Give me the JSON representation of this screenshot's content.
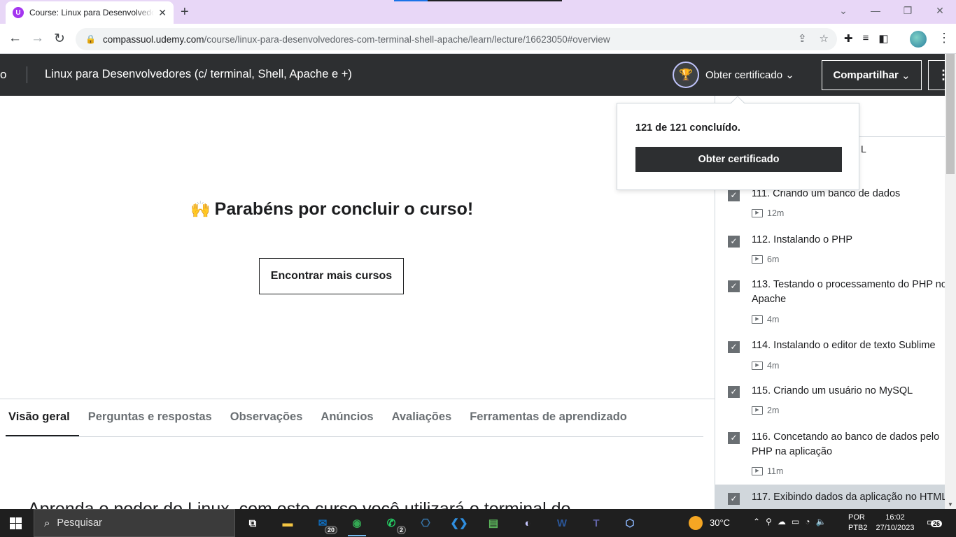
{
  "browser": {
    "tab_title": "Course: Linux para Desenvolvedores",
    "url_host": "compassuol.udemy.com",
    "url_path": "/course/linux-para-desenvolvedores-com-terminal-shell-apache/learn/lecture/16623050#overview"
  },
  "header": {
    "left_fragment": "o",
    "course_title": "Linux para Desenvolvedores (c/ terminal, Shell, Apache e +)",
    "get_certificate": "Obter certificado",
    "share": "Compartilhar"
  },
  "popover": {
    "progress": "121 de 121 concluído.",
    "button": "Obter certificado"
  },
  "main": {
    "emoji": "🙌",
    "congrats": "Parabéns por concluir o curso!",
    "find_more": "Encontrar mais cursos",
    "tabs": [
      {
        "label": "Visão geral",
        "active": true
      },
      {
        "label": "Perguntas e respostas",
        "active": false
      },
      {
        "label": "Observações",
        "active": false
      },
      {
        "label": "Anúncios",
        "active": false
      },
      {
        "label": "Avaliações",
        "active": false
      },
      {
        "label": "Ferramentas de aprendizado",
        "active": false
      }
    ],
    "description": "Aprenda o poder do Linux, com este curso você utilizará o terminal do"
  },
  "sidebar": {
    "hidden_fragment": "L",
    "lectures": [
      {
        "title": "111. Criando um banco de dados",
        "duration": "12m",
        "done": true
      },
      {
        "title": "112. Instalando o PHP",
        "duration": "6m",
        "done": true
      },
      {
        "title": "113. Testando o processamento do PHP no Apache",
        "duration": "4m",
        "done": true
      },
      {
        "title": "114. Instalando o editor de texto Sublime",
        "duration": "4m",
        "done": true
      },
      {
        "title": "115. Criando um usuário no MySQL",
        "duration": "2m",
        "done": true
      },
      {
        "title": "116. Concetando ao banco de dados pelo PHP na aplicação",
        "duration": "11m",
        "done": true
      },
      {
        "title": "117. Exibindo dados da aplicação no HTML",
        "duration": "",
        "done": true
      }
    ]
  },
  "taskbar": {
    "search_placeholder": "Pesquisar",
    "mail_badge": "20",
    "whatsapp_badge": "2",
    "temperature": "30°C",
    "lang_line1": "POR",
    "lang_line2": "PTB2",
    "time": "16:02",
    "date": "27/10/2023",
    "notifications": "26"
  },
  "colors": {
    "udemy_dark": "#2d2f31",
    "udemy_purple": "#a435f0",
    "tab_strip": "#e8d7f7"
  }
}
